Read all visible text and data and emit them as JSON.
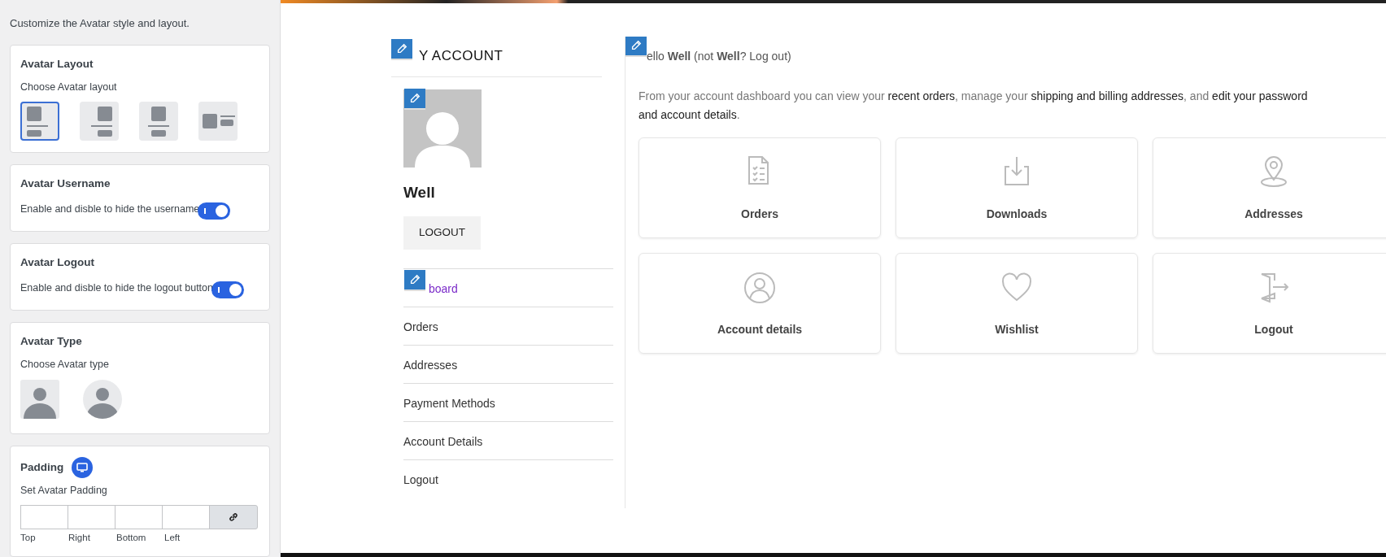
{
  "settings_panel": {
    "intro": "Customize the Avatar style and layout.",
    "sections": [
      {
        "kind": "layout",
        "title": "Avatar Layout",
        "description": "Choose Avatar layout",
        "options": [
          {
            "selected": true
          },
          {
            "selected": false
          },
          {
            "selected": false
          },
          {
            "selected": false
          }
        ]
      },
      {
        "kind": "toggle",
        "title": "Avatar Username",
        "description": "Enable and disble to hide the username",
        "on": true
      },
      {
        "kind": "toggle",
        "title": "Avatar Logout",
        "description": "Enable and disble to hide the logout button",
        "on": true
      },
      {
        "kind": "type",
        "title": "Avatar Type",
        "description": "Choose Avatar type",
        "options": [
          {
            "kind": "square"
          },
          {
            "kind": "circle"
          }
        ]
      },
      {
        "kind": "padding",
        "title": "Padding",
        "description": "Set Avatar Padding",
        "fields": [
          "Top",
          "Right",
          "Bottom",
          "Left"
        ]
      }
    ]
  },
  "account": {
    "title": "Y ACCOUNT",
    "username": "Well",
    "logout_button": "LOGOUT",
    "nav": [
      {
        "label": "board",
        "selected": true
      },
      {
        "label": "Orders",
        "selected": false
      },
      {
        "label": "Addresses",
        "selected": false
      },
      {
        "label": "Payment Methods",
        "selected": false
      },
      {
        "label": "Account Details",
        "selected": false
      },
      {
        "label": "Logout",
        "selected": false
      }
    ]
  },
  "dashboard": {
    "greeting": "ello **Well** (not **Well**? Log out)",
    "intro": [
      {
        "text": "From your account dashboard you can view your ",
        "link": false
      },
      {
        "text": "recent orders",
        "link": true
      },
      {
        "text": ", manage your ",
        "link": false
      },
      {
        "text": "shipping and billing addresses",
        "link": true
      },
      {
        "text": ", and ",
        "link": false
      },
      {
        "text": "edit your password",
        "link": true
      },
      {
        "text": "and account details",
        "link": true
      },
      {
        "text": ".",
        "link": false
      }
    ],
    "cards": [
      {
        "label": "Orders"
      },
      {
        "label": "Downloads"
      },
      {
        "label": "Addresses"
      },
      {
        "label": "Account details"
      },
      {
        "label": "Wishlist"
      },
      {
        "label": "Logout"
      }
    ]
  }
}
